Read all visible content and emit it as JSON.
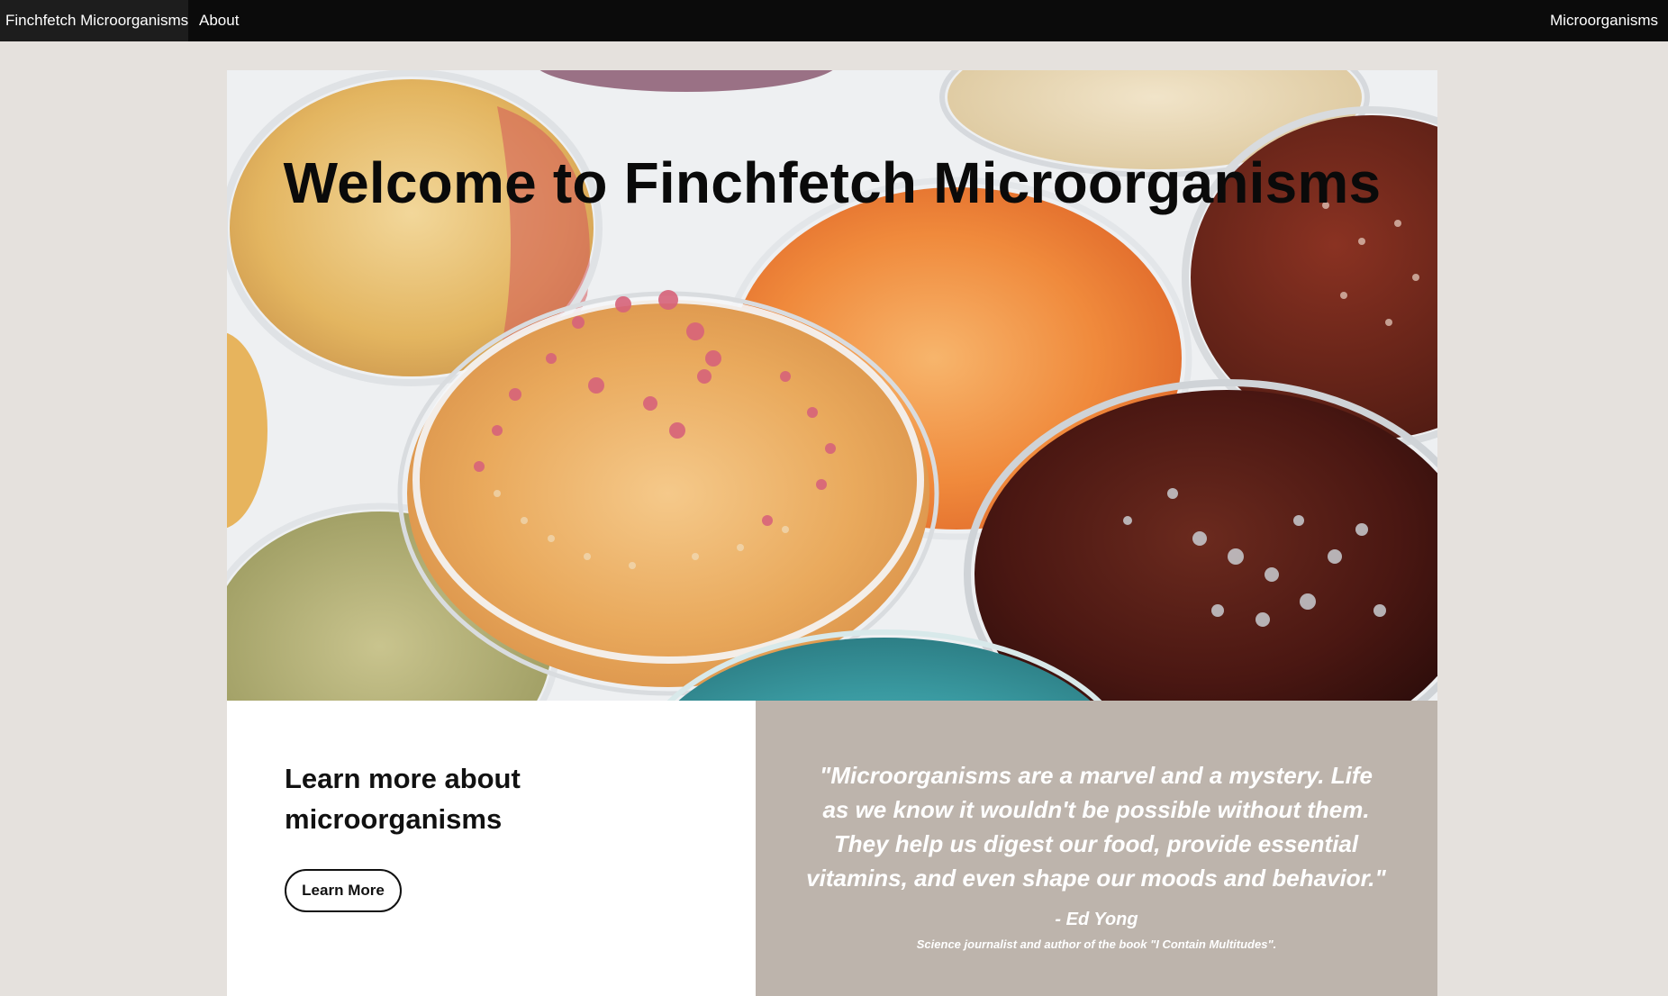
{
  "nav": {
    "brand": "Finchfetch Microorganisms",
    "about": "About",
    "right_link": "Microorganisms"
  },
  "hero": {
    "title": "Welcome to Finchfetch Microorganisms",
    "image_icon": "petri-dishes-photo"
  },
  "learn": {
    "heading": "Learn more about microorganisms",
    "button_label": "Learn More"
  },
  "quote": {
    "text": "\"Microorganisms are a marvel and a mystery. Life as we know it wouldn't be possible without them. They help us digest our food, provide essential vitamins, and even shape our moods and behavior.\"",
    "author": "- Ed Yong",
    "caption": "Science journalist and author of the book \"I Contain Multitudes\"."
  },
  "colors": {
    "navbar": "#0b0b0b",
    "page_background": "#e5e1dd",
    "quote_panel": "#bdb4ac"
  }
}
